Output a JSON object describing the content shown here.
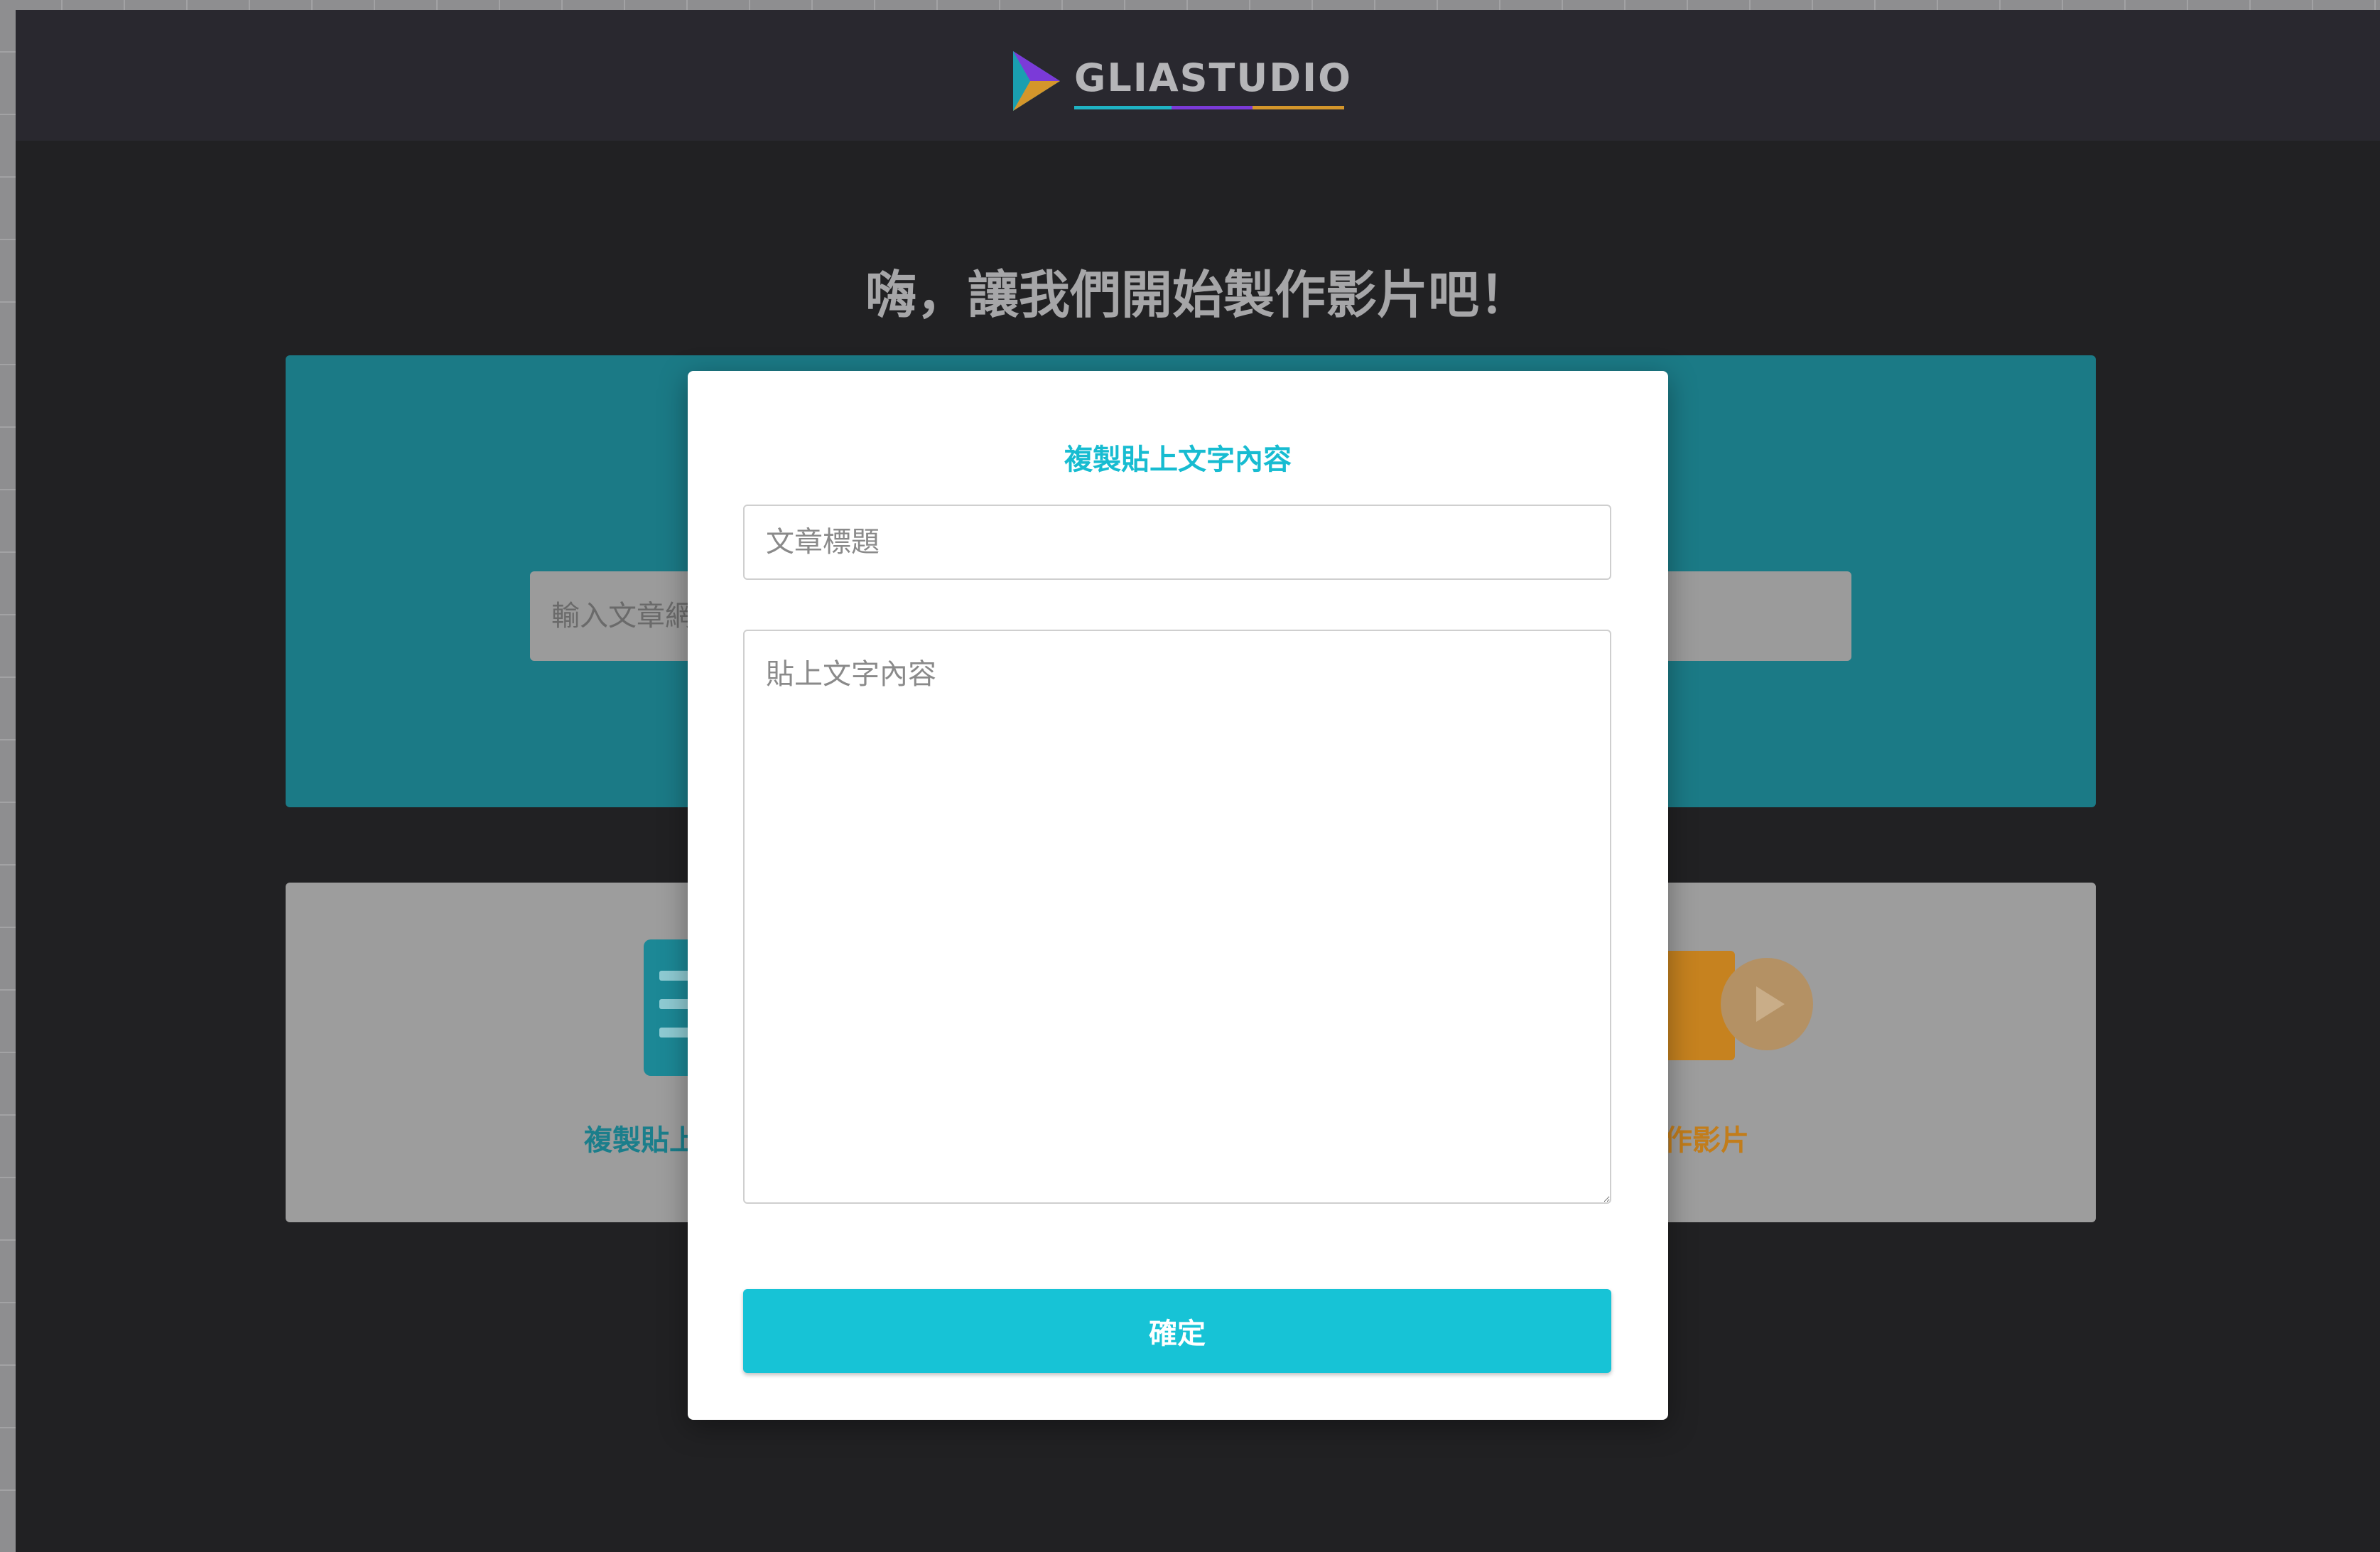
{
  "header": {
    "logo_text": "GLIASTUDIO"
  },
  "main": {
    "greeting": "嗨，讓我們開始製作影片吧！",
    "url_input_placeholder": "輸入文章網",
    "options": {
      "paste_label": "複製貼上文字內容",
      "start_label": "開始製作影片"
    }
  },
  "modal": {
    "title": "複製貼上文字內容",
    "title_field_placeholder": "文章標題",
    "body_field_placeholder": "貼上文字內容",
    "confirm_label": "確定"
  },
  "colors": {
    "accent": "#17c3d6",
    "hero": "#1b7a86",
    "orange": "#c6821f",
    "purple": "#7b3ad8"
  }
}
